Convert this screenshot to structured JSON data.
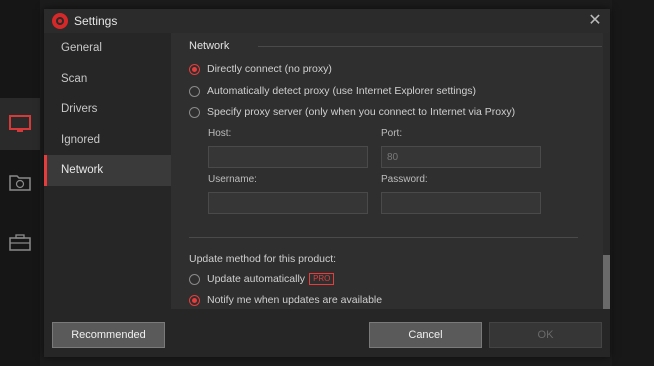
{
  "window": {
    "title": "Settings"
  },
  "sidebar": {
    "items": [
      {
        "label": "General"
      },
      {
        "label": "Scan"
      },
      {
        "label": "Drivers"
      },
      {
        "label": "Ignored"
      },
      {
        "label": "Network",
        "active": true
      }
    ]
  },
  "network": {
    "heading": "Network",
    "options": [
      {
        "label": "Directly connect (no proxy)",
        "selected": true
      },
      {
        "label": "Automatically detect proxy (use Internet Explorer settings)",
        "selected": false
      },
      {
        "label": "Specify proxy server (only when you connect to Internet via Proxy)",
        "selected": false
      }
    ],
    "host_label": "Host:",
    "host_value": "",
    "port_label": "Port:",
    "port_value": "80",
    "username_label": "Username:",
    "username_value": "",
    "password_label": "Password:",
    "password_value": ""
  },
  "update": {
    "label": "Update method for this product:",
    "options": [
      {
        "label": "Update automatically",
        "badge": "PRO",
        "selected": false
      },
      {
        "label": "Notify me when updates are available",
        "selected": true
      }
    ]
  },
  "footer": {
    "recommended_label": "Recommended",
    "cancel_label": "Cancel",
    "ok_label": "OK"
  },
  "colors": {
    "accent": "#e63c3c",
    "dialog_bg": "#2f2f2f",
    "sidebar_bg": "#262626"
  }
}
